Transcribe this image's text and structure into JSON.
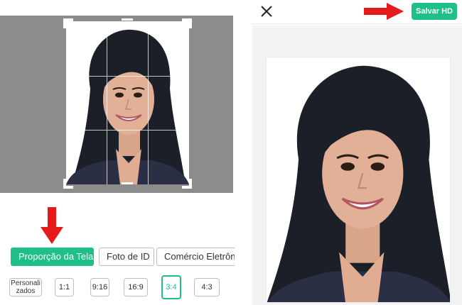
{
  "left_panel": {
    "tabs": [
      {
        "label": "Proporção da Tela",
        "active": true
      },
      {
        "label": "Foto de ID",
        "active": false
      },
      {
        "label": "Comércio Eletrônico",
        "active": false
      }
    ],
    "ratios": [
      {
        "label": "Personalizados",
        "line1": "Personali",
        "line2": "zados",
        "active": false
      },
      {
        "label": "1:1",
        "active": false
      },
      {
        "label": "9:16",
        "active": false
      },
      {
        "label": "16:9",
        "active": false
      },
      {
        "label": "3:4",
        "active": true
      },
      {
        "label": "4:3",
        "active": false
      }
    ]
  },
  "right_panel": {
    "save_label": "Salvar HD"
  },
  "colors": {
    "accent": "#1fbf8a",
    "arrow": "#e51b1b",
    "canvas_gray": "#8c8c8c"
  },
  "icons": {
    "close": "close-icon",
    "arrow_down": "red-arrow-down-icon",
    "arrow_right": "red-arrow-right-icon"
  }
}
